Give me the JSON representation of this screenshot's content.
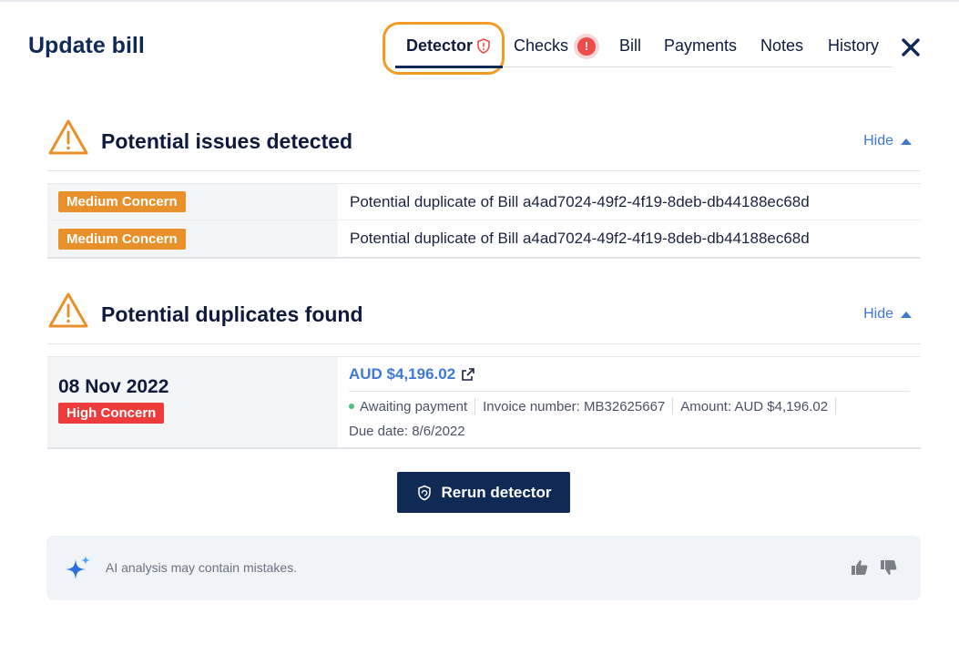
{
  "header": {
    "title": "Update bill",
    "close_icon": "close-x-icon"
  },
  "tabs": [
    {
      "label": "Detector",
      "active": true,
      "icon": "shield-alert-icon"
    },
    {
      "label": "Checks",
      "badge": "!"
    },
    {
      "label": "Bill"
    },
    {
      "label": "Payments"
    },
    {
      "label": "Notes"
    },
    {
      "label": "History"
    }
  ],
  "issues": {
    "title": "Potential issues detected",
    "hide_label": "Hide",
    "rows": [
      {
        "concern": "Medium Concern",
        "text": "Potential duplicate of Bill a4ad7024-49f2-4f19-8deb-db44188ec68d"
      },
      {
        "concern": "Medium Concern",
        "text": "Potential duplicate of Bill a4ad7024-49f2-4f19-8deb-db44188ec68d"
      }
    ]
  },
  "duplicates": {
    "title": "Potential duplicates found",
    "hide_label": "Hide",
    "item": {
      "date": "08 Nov 2022",
      "concern": "High Concern",
      "amount_link": "AUD $4,196.02",
      "status": "Awaiting payment",
      "invoice": "Invoice number: MB32625667",
      "amount": "Amount: AUD $4,196.02",
      "due": "Due date: 8/6/2022"
    }
  },
  "actions": {
    "rerun_label": "Rerun detector"
  },
  "ai_notice": {
    "text": "AI analysis may contain mistakes."
  },
  "colors": {
    "accent_navy": "#0f2a55",
    "link_blue": "#3f78d8",
    "medium_concern": "#e8902a",
    "high_concern": "#ee3b3b",
    "highlight_ring": "#f29b25"
  }
}
